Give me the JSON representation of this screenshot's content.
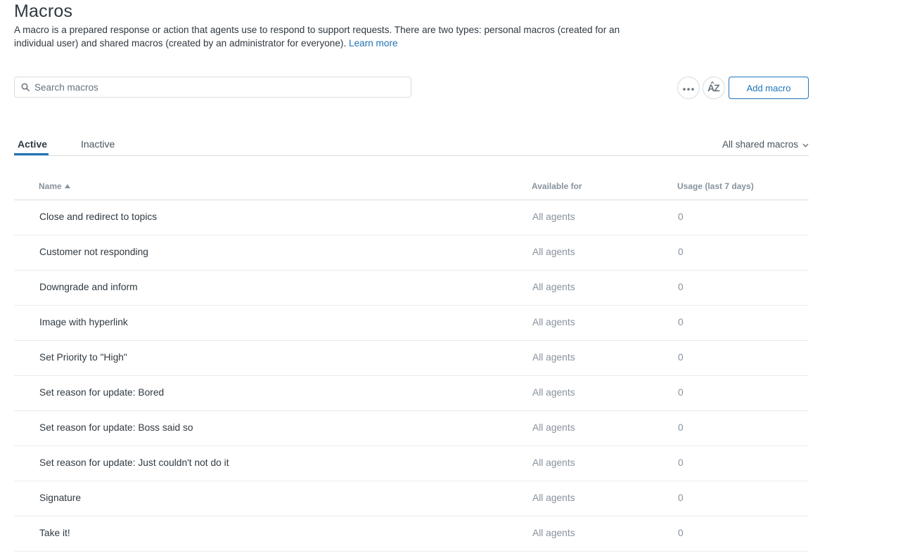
{
  "header": {
    "title": "Macros",
    "description": "A macro is a prepared response or action that agents use to respond to support requests. There are two types: personal macros (created for an individual user) and shared macros (created by an administrator for everyone).",
    "learn_more": "Learn more"
  },
  "toolbar": {
    "search_placeholder": "Search macros",
    "add_label": "Add macro",
    "sort_icon_label": "AZ"
  },
  "tabs": [
    {
      "label": "Active",
      "active": true
    },
    {
      "label": "Inactive",
      "active": false
    }
  ],
  "filter": {
    "label": "All shared macros"
  },
  "table": {
    "columns": [
      "Name",
      "Available for",
      "Usage (last 7 days)"
    ],
    "rows": [
      {
        "name": "Close and redirect to topics",
        "available": "All agents",
        "usage": "0"
      },
      {
        "name": "Customer not responding",
        "available": "All agents",
        "usage": "0"
      },
      {
        "name": "Downgrade and inform",
        "available": "All agents",
        "usage": "0"
      },
      {
        "name": "Image with hyperlink",
        "available": "All agents",
        "usage": "0"
      },
      {
        "name": "Set Priority to \"High\"",
        "available": "All agents",
        "usage": "0"
      },
      {
        "name": "Set reason for update: Bored",
        "available": "All agents",
        "usage": "0"
      },
      {
        "name": "Set reason for update: Boss said so",
        "available": "All agents",
        "usage": "0"
      },
      {
        "name": "Set reason for update: Just couldn't not do it",
        "available": "All agents",
        "usage": "0"
      },
      {
        "name": "Signature",
        "available": "All agents",
        "usage": "0"
      },
      {
        "name": "Take it!",
        "available": "All agents",
        "usage": "0"
      }
    ]
  },
  "colors": {
    "accent": "#1f73b7",
    "text": "#2f3941",
    "muted": "#87929d",
    "border": "#d8dcde"
  }
}
